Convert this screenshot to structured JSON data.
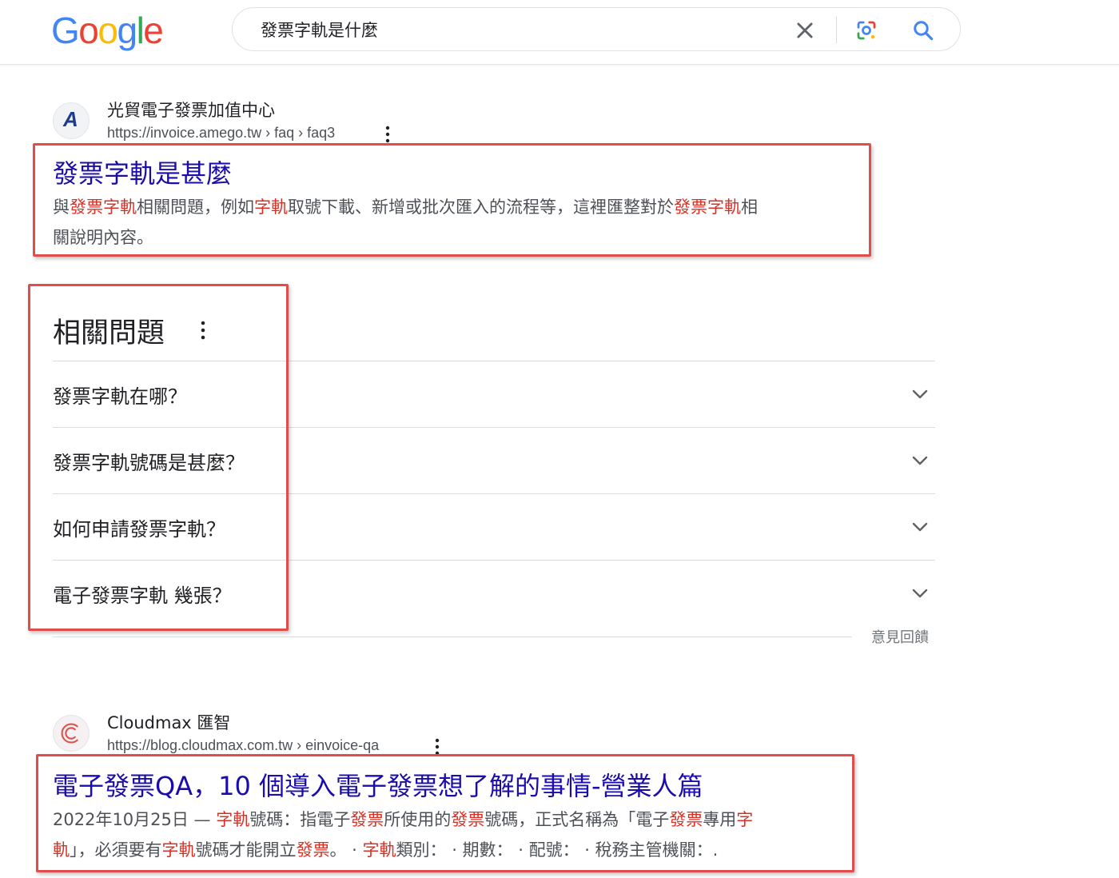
{
  "header": {
    "logo_letters": [
      "G",
      "o",
      "o",
      "g",
      "l",
      "e"
    ],
    "logo_colors": [
      "#4285F4",
      "#EA4335",
      "#FBBC05",
      "#4285F4",
      "#34A853",
      "#EA4335"
    ],
    "search_query": "發票字軌是什麼"
  },
  "results": [
    {
      "site_name": "光貿電子發票加值中心",
      "url": "https://invoice.amego.tw › faq › faq3",
      "favicon_letter": "A",
      "title": "發票字軌是甚麼",
      "snippet_line1": [
        {
          "t": "與",
          "hl": false
        },
        {
          "t": "發票字軌",
          "hl": true
        },
        {
          "t": "相關問題，例如",
          "hl": false
        },
        {
          "t": "字軌",
          "hl": true
        },
        {
          "t": "取號下載、新增或批次匯入的流程等，這裡匯整對於",
          "hl": false
        },
        {
          "t": "發票字軌",
          "hl": true
        },
        {
          "t": "相",
          "hl": false
        }
      ],
      "snippet_line2": [
        {
          "t": "關說明內容。",
          "hl": false
        }
      ]
    },
    {
      "site_name": "Cloudmax 匯智",
      "url": "https://blog.cloudmax.com.tw › einvoice-qa",
      "title": "電子發票QA，10 個導入電子發票想了解的事情-營業人篇",
      "snippet_line1": [
        {
          "t": "2022年10月25日 — ",
          "hl": false
        },
        {
          "t": "字軌",
          "hl": true
        },
        {
          "t": "號碼：指電子",
          "hl": false
        },
        {
          "t": "發票",
          "hl": true
        },
        {
          "t": "所使用的",
          "hl": false
        },
        {
          "t": "發票",
          "hl": true
        },
        {
          "t": "號碼，正式名稱為「電子",
          "hl": false
        },
        {
          "t": "發票",
          "hl": true
        },
        {
          "t": "專用",
          "hl": false
        },
        {
          "t": "字",
          "hl": true
        }
      ],
      "snippet_line2": [
        {
          "t": "軌",
          "hl": true
        },
        {
          "t": "」，必須要有",
          "hl": false
        },
        {
          "t": "字軌",
          "hl": true
        },
        {
          "t": "號碼才能開立",
          "hl": false
        },
        {
          "t": "發票",
          "hl": true
        },
        {
          "t": "。 · ",
          "hl": false
        },
        {
          "t": "字軌",
          "hl": true
        },
        {
          "t": "類別： · 期數： · 配號： · 稅務主管機關：.",
          "hl": false
        }
      ]
    }
  ],
  "paa": {
    "title": "相關問題",
    "questions": [
      "發票字軌在哪？",
      "發票字軌號碼是甚麼？",
      "如何申請發票字軌？",
      "電子發票字軌 幾張？"
    ],
    "feedback": "意見回饋"
  },
  "colors": {
    "link": "#1a0dab",
    "highlight": "#d93025",
    "annotation_box": "#e24c4b"
  }
}
